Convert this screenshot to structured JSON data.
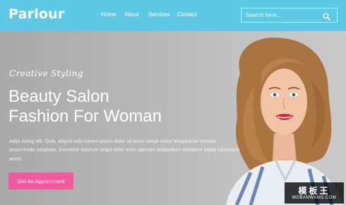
{
  "header": {
    "logo": "Parlour",
    "nav": [
      "Home",
      "About",
      "Services",
      "Contact"
    ],
    "search": {
      "placeholder": "Search here...",
      "icon": "search-icon"
    },
    "colors": {
      "background": "#5ec8e5"
    }
  },
  "hero": {
    "tagline": "Creative Styling",
    "headline_line1": "Beauty Salon",
    "headline_line2": "Fashion For Woman",
    "description": "Adipi sicing elit. Quia, aliquid odio Lorem ipsum dolor sit amet conse ctetur tempora ex veniam assumenda voluptate, inventore dolorum sequi dolor enim aperiam laudantium excepturi fugiat voluptatus animi.",
    "cta_label": "Get An Appointment",
    "colors": {
      "cta": "#f25aa0"
    }
  },
  "watermark": {
    "text": "模板王",
    "url": "MOBANWANG.COM"
  }
}
